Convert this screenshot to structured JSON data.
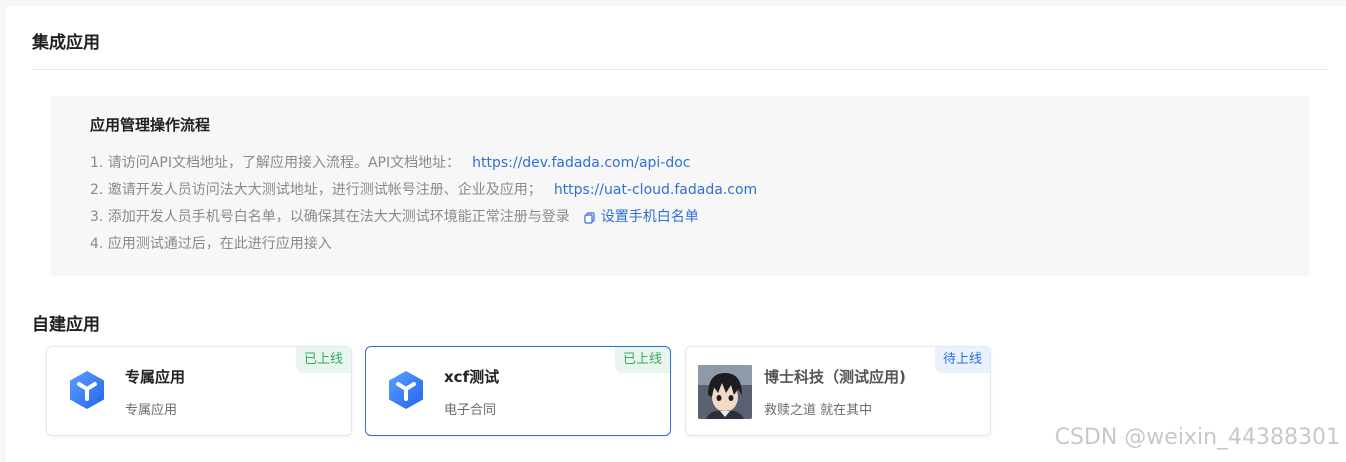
{
  "integration": {
    "title": "集成应用",
    "guide": {
      "title": "应用管理操作流程",
      "steps": [
        {
          "text": "1. 请访问API文档地址，了解应用接入流程。API文档地址：",
          "link": "https://dev.fadada.com/api-doc"
        },
        {
          "text": "2. 邀请开发人员访问法大大测试地址，进行测试帐号注册、企业及应用；",
          "link": "https://uat-cloud.fadada.com"
        },
        {
          "text": "3. 添加开发人员手机号白名单，以确保其在法大大测试环境能正常注册与登录",
          "link": "设置手机白名单"
        },
        {
          "text": "4. 应用测试通过后，在此进行应用接入",
          "link": ""
        }
      ]
    }
  },
  "self_built": {
    "title": "自建应用",
    "apps": [
      {
        "name": "专属应用",
        "desc": "专属应用",
        "status": "已上线",
        "icon": "cube-logo-icon"
      },
      {
        "name": "xcf测试",
        "desc": "电子合同",
        "status": "已上线",
        "icon": "cube-logo-icon"
      },
      {
        "name": "博士科技（测试应用)",
        "desc": "救赎之道 就在其中",
        "status": "待上线",
        "icon": "anime-avatar"
      }
    ]
  },
  "watermark": "CSDN @weixin_44388301",
  "colors": {
    "link": "#2f6fd9",
    "online": "#3aa765",
    "pending": "#2f6fd9",
    "logo": "#3b82f6"
  }
}
